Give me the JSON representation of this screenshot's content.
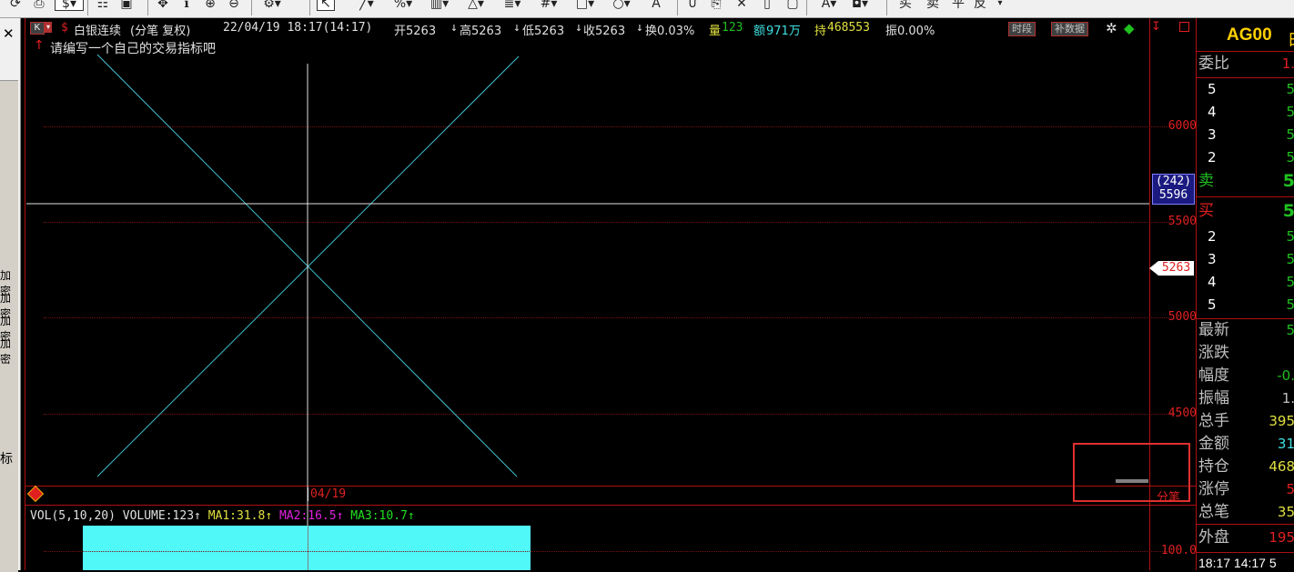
{
  "toolbar": {
    "icons": [
      {
        "name": "refresh-icon",
        "glyph": "⟳"
      },
      {
        "name": "print-icon",
        "glyph": "⎙"
      },
      {
        "name": "dollar-dropdown-icon",
        "glyph": "$▾"
      },
      {
        "name": "chart-type-icon",
        "glyph": "☷"
      },
      {
        "name": "window-icon",
        "glyph": "▣"
      },
      {
        "name": "move-icon",
        "glyph": "✥"
      },
      {
        "name": "info-icon",
        "glyph": "ℹ"
      },
      {
        "name": "zoom-in-icon",
        "glyph": "⊕"
      },
      {
        "name": "zoom-out-icon",
        "glyph": "⊖"
      },
      {
        "name": "settings-dropdown-icon",
        "glyph": "⚙▾"
      },
      {
        "name": "cursor-icon",
        "glyph": "↖"
      },
      {
        "name": "line-tool-icon",
        "glyph": "╱▾"
      },
      {
        "name": "percent-tool-icon",
        "glyph": "%▾"
      },
      {
        "name": "ruler-tool-icon",
        "glyph": "▥▾"
      },
      {
        "name": "triangle-tool-icon",
        "glyph": "△▾"
      },
      {
        "name": "channel-tool-icon",
        "glyph": "≣▾"
      },
      {
        "name": "grid-tool-icon",
        "glyph": "#▾"
      },
      {
        "name": "rectangle-tool-icon",
        "glyph": "□▾"
      },
      {
        "name": "ellipse-tool-icon",
        "glyph": "○▾"
      },
      {
        "name": "text-tool-icon",
        "glyph": "A"
      },
      {
        "name": "magnet-icon",
        "glyph": "∪"
      },
      {
        "name": "copy-icon",
        "glyph": "⎘"
      },
      {
        "name": "delete-icon",
        "glyph": "✕"
      },
      {
        "name": "trash-icon",
        "glyph": "▯"
      },
      {
        "name": "lock-icon",
        "glyph": "▢"
      },
      {
        "name": "text-color-icon",
        "glyph": "A▾"
      },
      {
        "name": "fill-color-icon",
        "glyph": "◘▾"
      }
    ],
    "trade_buttons": [
      {
        "name": "buy-open-button",
        "label": "买"
      },
      {
        "name": "sell-open-button",
        "label": "卖"
      },
      {
        "name": "close-position-button",
        "label": "平"
      },
      {
        "name": "reverse-position-button",
        "label": "反"
      }
    ]
  },
  "left_panel": {
    "close_glyph": "✕",
    "items": [
      "加密",
      "加密",
      "加密",
      "加密"
    ],
    "bottom_label": "标"
  },
  "header": {
    "period_box": "K",
    "currency_icon": "$",
    "symbol_name": "白银连续",
    "mode": "(分笔 复权)",
    "datetime": "22/04/19 18:17(14:17)",
    "open": "开5263",
    "high": "高5263",
    "low": "低5263",
    "close": "收5263",
    "turnover": "换0.03%",
    "volume_label": "量",
    "volume": "123",
    "amount_label": "额",
    "amount": "971万",
    "open_interest_label": "持",
    "open_interest": "468553",
    "amplitude": "振0.00%",
    "hint": "请编写一个自己的交易指标吧",
    "btn_timeshare": "时段",
    "btn_supplement": "补数据",
    "colors": {
      "accent_red": "#e02020",
      "cyan": "#40e0e0",
      "yellow": "#e0e040",
      "green": "#20c020",
      "magenta": "#e020e0"
    }
  },
  "price_axis": {
    "ticks": [
      "6000",
      "5500",
      "5000",
      "4500"
    ],
    "crosshair_label_top": "(242)",
    "crosshair_label_bottom": "5596",
    "last_price_marker": "5263"
  },
  "time_axis": {
    "date_label": "04/19",
    "mode_label": "分笔"
  },
  "volume_panel": {
    "title": "VOL(5,10,20)",
    "volume": "VOLUME:123",
    "ma1": "MA1:31.8",
    "ma2": "MA2:16.5",
    "ma3": "MA3:10.7",
    "y_tick": "100.0",
    "arrow": "↑"
  },
  "right_panel": {
    "symbol": "AG00",
    "symbol_suffix": "白",
    "ratio_label": "委比",
    "ratio_value": "1.",
    "sell_levels": [
      {
        "label": "5",
        "value": "5"
      },
      {
        "label": "4",
        "value": "5"
      },
      {
        "label": "3",
        "value": "5"
      },
      {
        "label": "2",
        "value": "5"
      }
    ],
    "sell_label": "卖",
    "sell_value": "5",
    "buy_label": "买",
    "buy_value": "5",
    "buy_levels": [
      {
        "label": "2",
        "value": "5"
      },
      {
        "label": "3",
        "value": "5"
      },
      {
        "label": "4",
        "value": "5"
      },
      {
        "label": "5",
        "value": "5"
      }
    ],
    "stats": [
      {
        "label": "最新",
        "value": "5",
        "color": "#20c020"
      },
      {
        "label": "涨跌",
        "value": "",
        "color": "#20c020"
      },
      {
        "label": "幅度",
        "value": "-0.",
        "color": "#20c020"
      },
      {
        "label": "振幅",
        "value": "1.",
        "color": "#c0c0c0"
      },
      {
        "label": "总手",
        "value": "395",
        "color": "#e0e040"
      },
      {
        "label": "金额",
        "value": "31",
        "color": "#40e0e0"
      },
      {
        "label": "持仓",
        "value": "468",
        "color": "#e0e040"
      },
      {
        "label": "涨停",
        "value": "5",
        "color": "#e02020"
      },
      {
        "label": "总笔",
        "value": "35",
        "color": "#e0e040"
      }
    ],
    "outer_label": "外盘",
    "outer_value": "195",
    "time_row": "18:17 14:17 5"
  }
}
